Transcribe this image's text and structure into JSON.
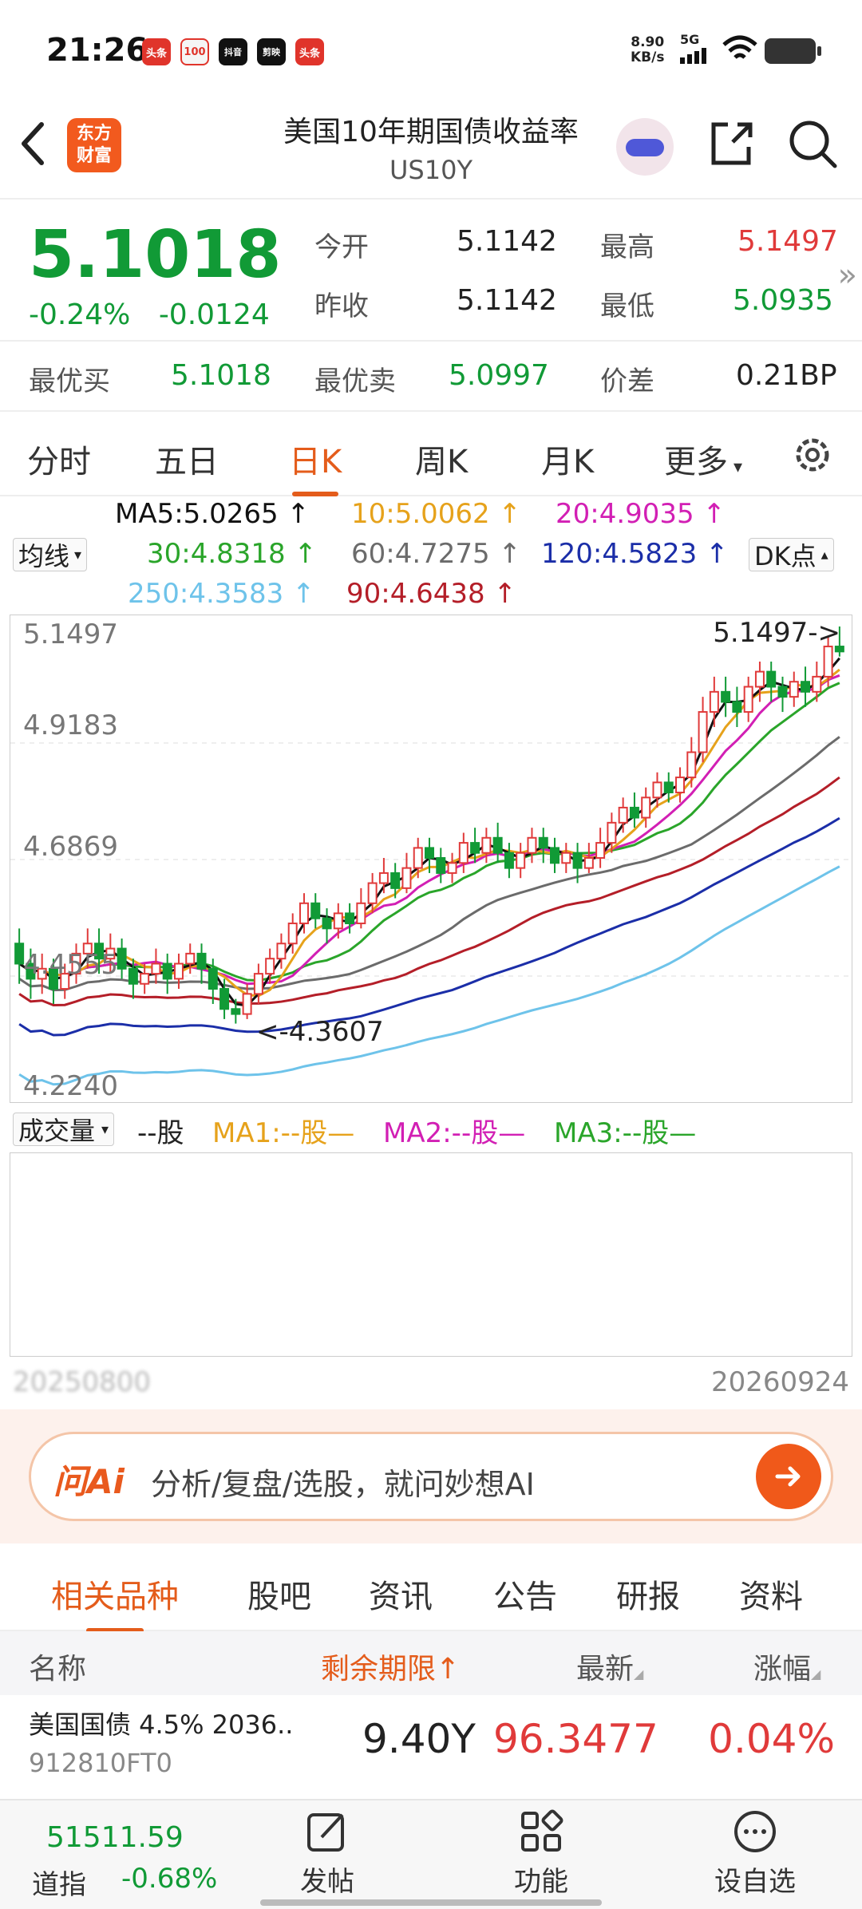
{
  "status_bar": {
    "time": "21:26",
    "net_speed": "8.90",
    "net_unit": "KB/s",
    "signal_label": "5G",
    "app_icons": [
      "头条",
      "100",
      "抖音",
      "剪映",
      "头条"
    ]
  },
  "header": {
    "logo_line1": "东方",
    "logo_line2": "财富",
    "title": "美国10年期国债收益率",
    "code": "US10Y"
  },
  "quote": {
    "price": "5.1018",
    "change_pct": "-0.24%",
    "change_abs": "-0.0124",
    "open_label": "今开",
    "open_value": "5.1142",
    "high_label": "最高",
    "high_value": "5.1497",
    "prev_close_label": "昨收",
    "prev_close_value": "5.1142",
    "low_label": "最低",
    "low_value": "5.0935",
    "best_bid_label": "最优买",
    "best_bid_value": "5.1018",
    "best_ask_label": "最优卖",
    "best_ask_value": "5.0997",
    "spread_label": "价差",
    "spread_value": "0.21BP"
  },
  "colors": {
    "up": "#e03a3a",
    "down": "#119a36",
    "accent": "#e45c1b",
    "ma5": "#111111",
    "ma10": "#e6a21b",
    "ma20": "#d21fb4",
    "ma30": "#2aa52a",
    "ma60": "#6b6b6b",
    "ma120": "#1b2ea8",
    "ma250": "#6ec3ea",
    "ma90": "#b41e28"
  },
  "k_tabs": [
    "分时",
    "五日",
    "日K",
    "周K",
    "月K",
    "更多"
  ],
  "ma_selector": "均线",
  "dk_label": "DK点",
  "ma_legend": {
    "ma5": "MA5:5.0265 ↑",
    "ma10": "10:5.0062 ↑",
    "ma20": "20:4.9035 ↑",
    "ma30": "30:4.8318 ↑",
    "ma60": "60:4.7275 ↑",
    "ma120": "120:4.5823 ↑",
    "ma250": "250:4.3583 ↑",
    "ma90": "90:4.6438 ↑"
  },
  "chart_data": {
    "type": "candlestick",
    "y_ticks": [
      "5.1497",
      "4.9183",
      "4.6869",
      "4.4555",
      "4.2240"
    ],
    "ylim": [
      4.224,
      5.1497
    ],
    "max_annotation": "5.1497->",
    "min_annotation": "<-4.3607",
    "series_note": "daily candles",
    "candles": [
      [
        4.52,
        4.48,
        4.55,
        4.44
      ],
      [
        4.48,
        4.45,
        4.51,
        4.41
      ],
      [
        4.45,
        4.47,
        4.5,
        4.42
      ],
      [
        4.47,
        4.43,
        4.49,
        4.4
      ],
      [
        4.43,
        4.46,
        4.48,
        4.41
      ],
      [
        4.46,
        4.5,
        4.52,
        4.44
      ],
      [
        4.5,
        4.52,
        4.55,
        4.47
      ],
      [
        4.52,
        4.49,
        4.55,
        4.46
      ],
      [
        4.49,
        4.51,
        4.54,
        4.46
      ],
      [
        4.51,
        4.47,
        4.53,
        4.45
      ],
      [
        4.47,
        4.44,
        4.49,
        4.41
      ],
      [
        4.44,
        4.46,
        4.48,
        4.42
      ],
      [
        4.46,
        4.48,
        4.51,
        4.44
      ],
      [
        4.48,
        4.45,
        4.5,
        4.42
      ],
      [
        4.45,
        4.48,
        4.5,
        4.43
      ],
      [
        4.48,
        4.5,
        4.52,
        4.46
      ],
      [
        4.5,
        4.47,
        4.52,
        4.44
      ],
      [
        4.47,
        4.43,
        4.49,
        4.4
      ],
      [
        4.43,
        4.39,
        4.45,
        4.37
      ],
      [
        4.39,
        4.38,
        4.41,
        4.361
      ],
      [
        4.38,
        4.42,
        4.44,
        4.37
      ],
      [
        4.42,
        4.46,
        4.48,
        4.4
      ],
      [
        4.46,
        4.49,
        4.51,
        4.44
      ],
      [
        4.49,
        4.52,
        4.54,
        4.47
      ],
      [
        4.52,
        4.56,
        4.58,
        4.5
      ],
      [
        4.56,
        4.6,
        4.62,
        4.54
      ],
      [
        4.6,
        4.57,
        4.62,
        4.55
      ],
      [
        4.57,
        4.55,
        4.59,
        4.52
      ],
      [
        4.55,
        4.58,
        4.6,
        4.53
      ],
      [
        4.58,
        4.56,
        4.6,
        4.54
      ],
      [
        4.56,
        4.6,
        4.63,
        4.55
      ],
      [
        4.6,
        4.64,
        4.66,
        4.58
      ],
      [
        4.64,
        4.66,
        4.69,
        4.62
      ],
      [
        4.66,
        4.63,
        4.68,
        4.61
      ],
      [
        4.63,
        4.67,
        4.7,
        4.62
      ],
      [
        4.67,
        4.71,
        4.73,
        4.65
      ],
      [
        4.71,
        4.69,
        4.73,
        4.66
      ],
      [
        4.69,
        4.66,
        4.71,
        4.64
      ],
      [
        4.66,
        4.68,
        4.7,
        4.64
      ],
      [
        4.68,
        4.72,
        4.74,
        4.66
      ],
      [
        4.72,
        4.7,
        4.75,
        4.68
      ],
      [
        4.7,
        4.73,
        4.75,
        4.68
      ],
      [
        4.73,
        4.7,
        4.76,
        4.68
      ],
      [
        4.7,
        4.67,
        4.72,
        4.65
      ],
      [
        4.67,
        4.7,
        4.72,
        4.65
      ],
      [
        4.7,
        4.73,
        4.75,
        4.68
      ],
      [
        4.73,
        4.71,
        4.75,
        4.68
      ],
      [
        4.71,
        4.68,
        4.73,
        4.66
      ],
      [
        4.68,
        4.7,
        4.72,
        4.66
      ],
      [
        4.7,
        4.67,
        4.72,
        4.64
      ],
      [
        4.67,
        4.69,
        4.72,
        4.66
      ],
      [
        4.69,
        4.72,
        4.75,
        4.67
      ],
      [
        4.72,
        4.76,
        4.78,
        4.7
      ],
      [
        4.76,
        4.79,
        4.81,
        4.74
      ],
      [
        4.79,
        4.77,
        4.82,
        4.75
      ],
      [
        4.77,
        4.81,
        4.83,
        4.75
      ],
      [
        4.81,
        4.84,
        4.86,
        4.79
      ],
      [
        4.84,
        4.82,
        4.86,
        4.8
      ],
      [
        4.82,
        4.85,
        4.87,
        4.8
      ],
      [
        4.85,
        4.9,
        4.93,
        4.83
      ],
      [
        4.9,
        4.98,
        5.01,
        4.88
      ],
      [
        4.98,
        5.02,
        5.05,
        4.95
      ],
      [
        5.02,
        5.0,
        5.05,
        4.97
      ],
      [
        5.0,
        4.98,
        5.03,
        4.95
      ],
      [
        4.98,
        5.03,
        5.05,
        4.96
      ],
      [
        5.03,
        5.06,
        5.08,
        5.0
      ],
      [
        5.06,
        5.03,
        5.08,
        5.0
      ],
      [
        5.03,
        5.01,
        5.05,
        4.98
      ],
      [
        5.01,
        5.04,
        5.06,
        4.99
      ],
      [
        5.04,
        5.02,
        5.07,
        4.99
      ],
      [
        5.02,
        5.05,
        5.08,
        5.0
      ],
      [
        5.05,
        5.11,
        5.13,
        5.03
      ],
      [
        5.11,
        5.1,
        5.1497,
        5.09
      ]
    ]
  },
  "volume": {
    "selector": "成交量",
    "unit": "--股",
    "ma1": "MA1:--股—",
    "ma2": "MA2:--股—",
    "ma3": "MA3:--股—",
    "start_date": "20250800",
    "end_date": "20260924"
  },
  "ai_bar": {
    "logo": "问Ai",
    "placeholder": "分析/复盘/选股，就问妙想AI"
  },
  "bottom_tabs": [
    "相关品种",
    "股吧",
    "资讯",
    "公告",
    "研报",
    "资料"
  ],
  "table": {
    "headers": {
      "name": "名称",
      "remaining": "剩余期限↑",
      "latest": "最新",
      "change": "涨幅"
    },
    "rows": [
      {
        "name": "美国国债 4.5% 2036..",
        "code": "912810FT0",
        "remaining": "9.40Y",
        "latest": "96.3477",
        "change": "0.04%"
      }
    ]
  },
  "bottom_bar": {
    "index_value": "51511.59",
    "index_name": "道指",
    "index_change": "-0.68%",
    "post": "发帖",
    "functions": "功能",
    "watchlist": "设自选"
  }
}
